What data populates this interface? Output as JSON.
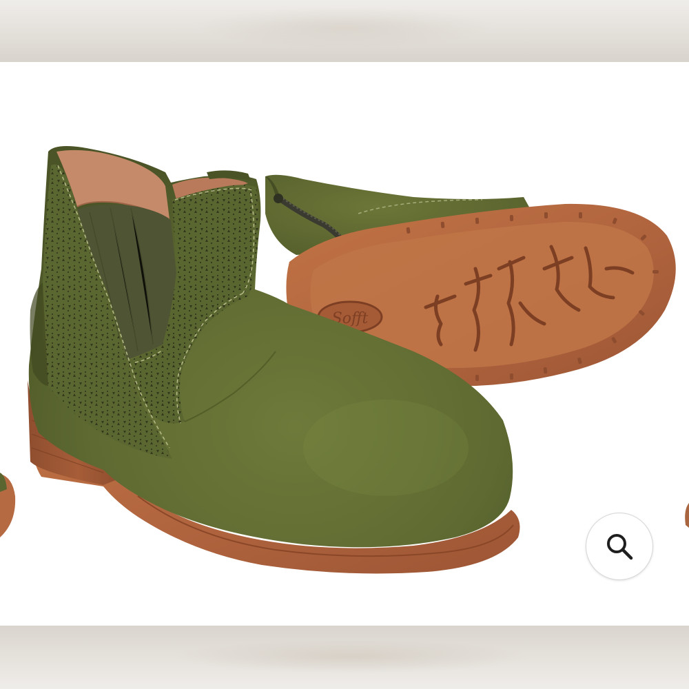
{
  "product": {
    "sole_logo_text": "Sofft",
    "colors": {
      "suede": "#5e6a31",
      "sole": "#b0643e",
      "lining": "#c58a6a",
      "elastic": "#4f5534"
    }
  },
  "zoom": {
    "icon": "magnifier-icon",
    "color": "#1f1f1f"
  }
}
